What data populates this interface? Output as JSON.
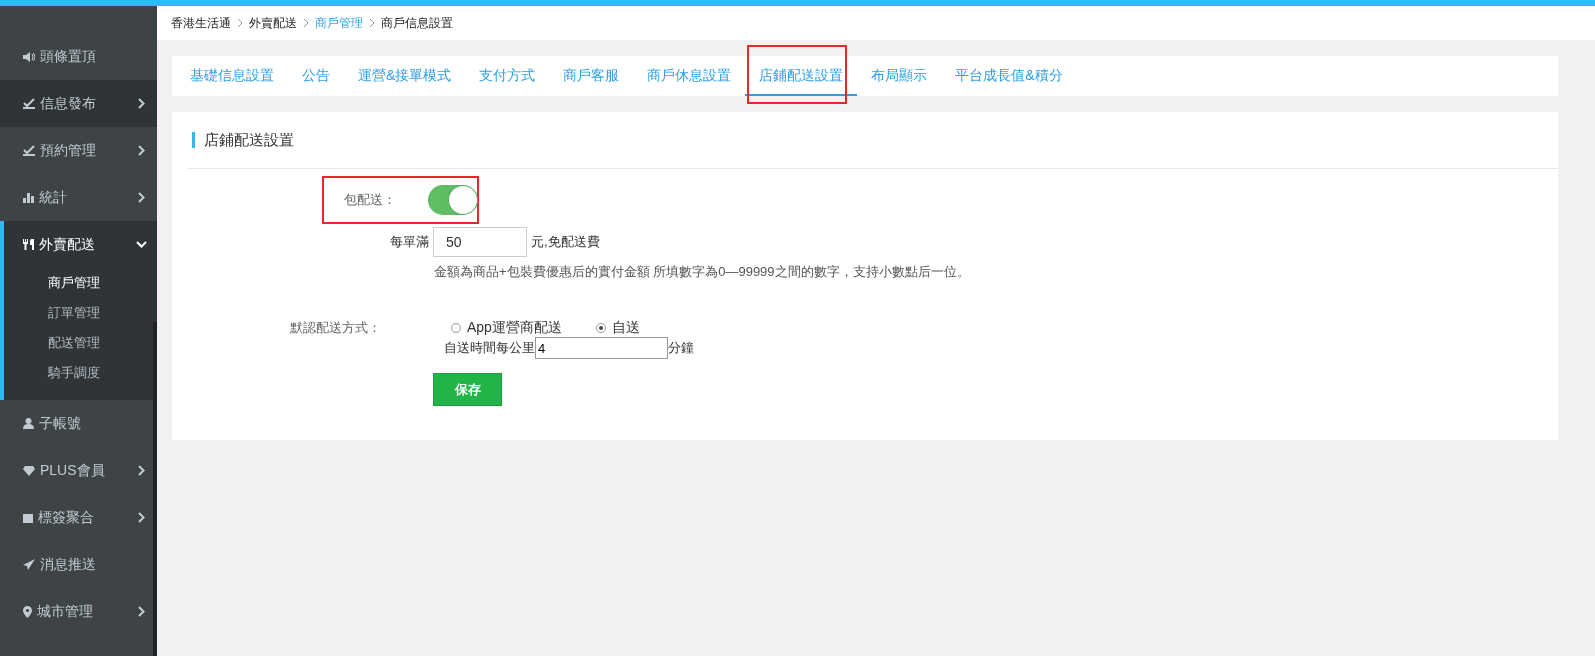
{
  "sidebar": {
    "items": [
      {
        "label": "頭條置頂",
        "has_submenu": false,
        "expanded": false,
        "hovered": false
      },
      {
        "label": "信息發布",
        "has_submenu": true,
        "expanded": false,
        "hovered": true
      },
      {
        "label": "預約管理",
        "has_submenu": true,
        "expanded": false,
        "hovered": false
      },
      {
        "label": "統計",
        "has_submenu": true,
        "expanded": false,
        "hovered": false
      },
      {
        "label": "外賣配送",
        "has_submenu": true,
        "expanded": true,
        "hovered": false,
        "children": [
          {
            "label": "商戶管理",
            "selected": true
          },
          {
            "label": "訂單管理",
            "selected": false
          },
          {
            "label": "配送管理",
            "selected": false
          },
          {
            "label": "騎手調度",
            "selected": false
          }
        ]
      },
      {
        "label": "子帳號",
        "has_submenu": false,
        "expanded": false,
        "hovered": false
      },
      {
        "label": "PLUS會員",
        "has_submenu": true,
        "expanded": false,
        "hovered": false
      },
      {
        "label": "標簽聚合",
        "has_submenu": true,
        "expanded": false,
        "hovered": false
      },
      {
        "label": "消息推送",
        "has_submenu": false,
        "expanded": false,
        "hovered": false
      },
      {
        "label": "城市管理",
        "has_submenu": true,
        "expanded": false,
        "hovered": false
      }
    ]
  },
  "breadcrumb": [
    {
      "label": "香港生活通",
      "link": false
    },
    {
      "label": "外賣配送",
      "link": false
    },
    {
      "label": "商戶管理",
      "link": true
    },
    {
      "label": "商戶信息設置",
      "link": false
    }
  ],
  "tabs": [
    {
      "label": "基礎信息設置",
      "selected": false,
      "highlighted": false
    },
    {
      "label": "公告",
      "selected": false,
      "highlighted": false
    },
    {
      "label": "運營&接單模式",
      "selected": false,
      "highlighted": false
    },
    {
      "label": "支付方式",
      "selected": false,
      "highlighted": false
    },
    {
      "label": "商戶客服",
      "selected": false,
      "highlighted": false
    },
    {
      "label": "商戶休息設置",
      "selected": false,
      "highlighted": false
    },
    {
      "label": "店鋪配送設置",
      "selected": true,
      "highlighted": true
    },
    {
      "label": "布局顯示",
      "selected": false,
      "highlighted": false
    },
    {
      "label": "平台成長值&積分",
      "selected": false,
      "highlighted": false
    }
  ],
  "form": {
    "title": "店鋪配送設置",
    "free_delivery": {
      "label": "包配送：",
      "on": true,
      "highlighted": true
    },
    "threshold": {
      "prefix": "每單滿",
      "value": "50",
      "suffix": "元,免配送費"
    },
    "note": "金額為商品+包裝費優惠后的實付金額 所填數字為0—99999之間的數字，支持小數點后一位。",
    "delivery_method": {
      "label": "默認配送方式：",
      "options": [
        {
          "label": "App運營商配送",
          "selected": false
        },
        {
          "label": "自送",
          "selected": true
        }
      ]
    },
    "self_time": {
      "prefix": "自送時間每公里",
      "value": "4",
      "suffix": "分鐘"
    },
    "save_button": "保存"
  }
}
